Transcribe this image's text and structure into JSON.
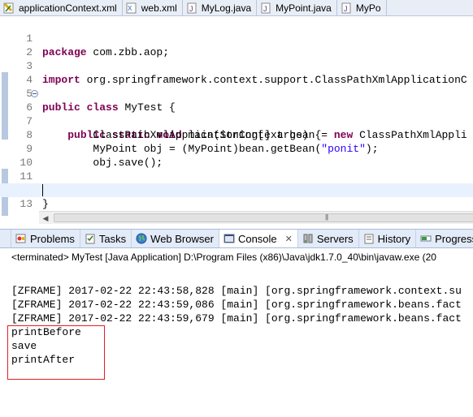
{
  "editor_tabs": [
    {
      "label": "applicationContext.xml",
      "icon": "xml-file-icon"
    },
    {
      "label": "web.xml",
      "icon": "xml-file-icon"
    },
    {
      "label": "MyLog.java",
      "icon": "java-file-icon"
    },
    {
      "label": "MyPoint.java",
      "icon": "java-file-icon"
    },
    {
      "label": "MyPo",
      "icon": "java-file-icon"
    }
  ],
  "code": {
    "line_numbers": [
      "1",
      "2",
      "3",
      "4",
      "5",
      "6",
      "7",
      "8",
      "9",
      "10",
      "11",
      "12",
      "13"
    ],
    "line1": {
      "kw": "package",
      "rest": " com.zbb.aop;"
    },
    "line3": {
      "kw": "import",
      "rest": " org.springframework.context.support.ClassPathXmlApplicationC"
    },
    "line5": {
      "kw1": "public",
      "kw2": "class",
      "rest": " MyTest {"
    },
    "line6": {
      "indent": "    ",
      "kw1": "public",
      "kw2": "static",
      "kw3": "void",
      "rest": " main(String[] args) {"
    },
    "line7": {
      "indent": "        ",
      "text": "ClassPathXmlApplicationContext bean = ",
      "kw": "new",
      "rest": " ClassPathXmlAppli"
    },
    "line8": {
      "indent": "        ",
      "text": "MyPoint obj = (MyPoint)bean.getBean(",
      "str": "\"ponit\"",
      "rest": ");"
    },
    "line9": {
      "indent": "        ",
      "text": "obj.save();"
    },
    "line11": {
      "text": "    }"
    },
    "line12": {
      "text": "}"
    },
    "current_line": "13"
  },
  "view_tabs": [
    {
      "label": "Problems",
      "icon": "problems-icon",
      "active": false
    },
    {
      "label": "Tasks",
      "icon": "tasks-icon",
      "active": false
    },
    {
      "label": "Web Browser",
      "icon": "globe-icon",
      "active": false
    },
    {
      "label": "Console",
      "icon": "console-icon",
      "active": true,
      "close": "✕"
    },
    {
      "label": "Servers",
      "icon": "servers-icon",
      "active": false
    },
    {
      "label": "History",
      "icon": "history-icon",
      "active": false
    },
    {
      "label": "Progress",
      "icon": "progress-icon",
      "active": false
    }
  ],
  "console": {
    "status": "<terminated> MyTest [Java Application] D:\\Program Files (x86)\\Java\\jdk1.7.0_40\\bin\\javaw.exe (20",
    "lines": [
      "[ZFRAME] 2017-02-22 22:43:58,828 [main] [org.springframework.context.su",
      "[ZFRAME] 2017-02-22 22:43:59,086 [main] [org.springframework.beans.fact",
      "[ZFRAME] 2017-02-22 22:43:59,679 [main] [org.springframework.beans.fact",
      "printBefore",
      "save",
      "printAfter"
    ]
  },
  "colors": {
    "keyword": "#7f0055",
    "string": "#2a00ff",
    "highlight_box": "#e02020",
    "current_line": "#e8f2fe"
  }
}
